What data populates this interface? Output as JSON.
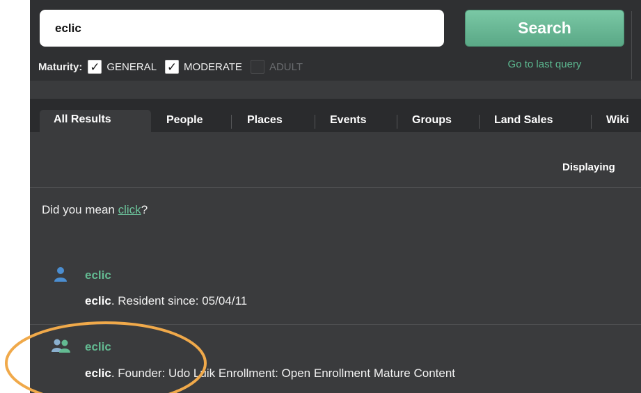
{
  "search": {
    "query": "eclic",
    "button_label": "Search",
    "last_query_link": "Go to last query"
  },
  "maturity": {
    "label": "Maturity:",
    "options": [
      {
        "label": "GENERAL",
        "checked": true
      },
      {
        "label": "MODERATE",
        "checked": true
      },
      {
        "label": "ADULT",
        "checked": false
      }
    ],
    "check_glyph": "✓"
  },
  "tabs": [
    {
      "label": "All Results",
      "active": true
    },
    {
      "label": "People",
      "active": false
    },
    {
      "label": "Places",
      "active": false
    },
    {
      "label": "Events",
      "active": false
    },
    {
      "label": "Groups",
      "active": false
    },
    {
      "label": "Land Sales",
      "active": false
    },
    {
      "label": "Wiki",
      "active": false
    }
  ],
  "display_text": "Displaying",
  "suggestion": {
    "prefix": "Did you mean ",
    "link": "click",
    "suffix": "?"
  },
  "results": [
    {
      "type": "person",
      "icon": "person-icon",
      "title": "eclic",
      "name_bold": "eclic",
      "description": ". Resident since: 05/04/11"
    },
    {
      "type": "group",
      "icon": "group-icon",
      "title": "eclic",
      "name_bold": "eclic",
      "description": ". Founder: Udo Luik Enrollment: Open Enrollment Mature Content"
    }
  ],
  "colors": {
    "accent_green": "#63bb92",
    "person_icon_blue": "#4b8ed1",
    "highlight_orange": "#f0a94a",
    "panel_bg": "#3a3b3d"
  }
}
